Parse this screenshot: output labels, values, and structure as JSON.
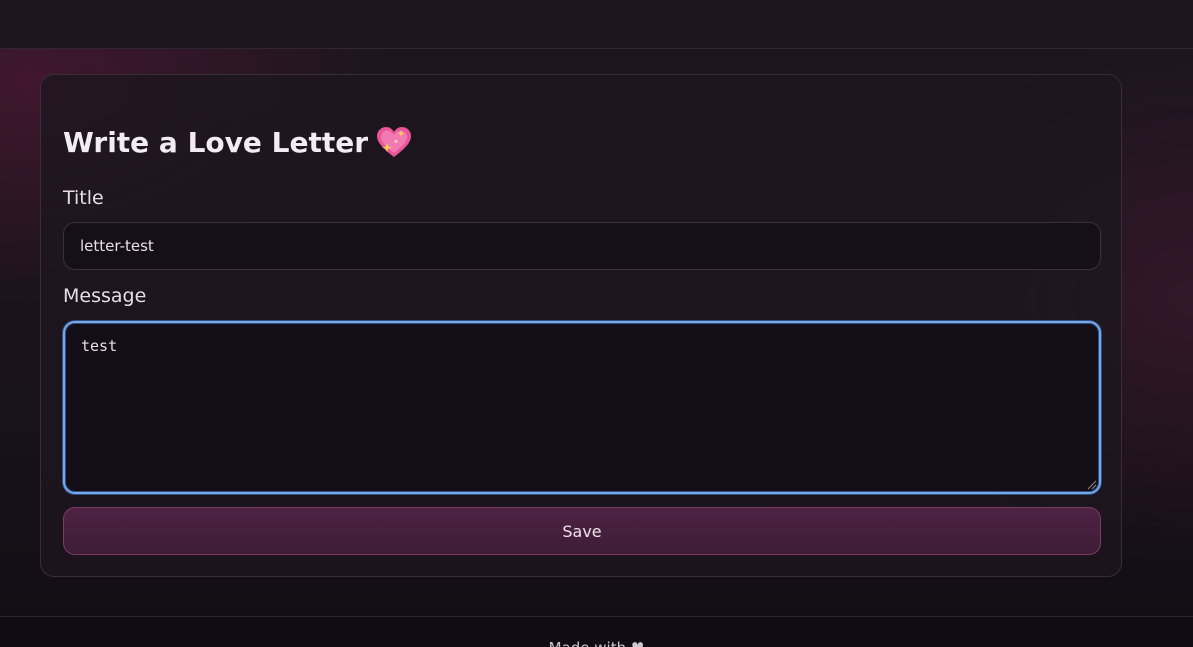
{
  "form": {
    "heading": "Write a Love Letter",
    "heading_icon": "sparkling-heart-icon",
    "title_label": "Title",
    "title_value": "letter-test",
    "message_label": "Message",
    "message_value": "test",
    "save_label": "Save"
  },
  "footer": {
    "text": "Made with ♥"
  },
  "colors": {
    "accent_pink": "#e8559a",
    "focus_ring": "#7aa7e6",
    "button_bg": "#4e2343"
  }
}
